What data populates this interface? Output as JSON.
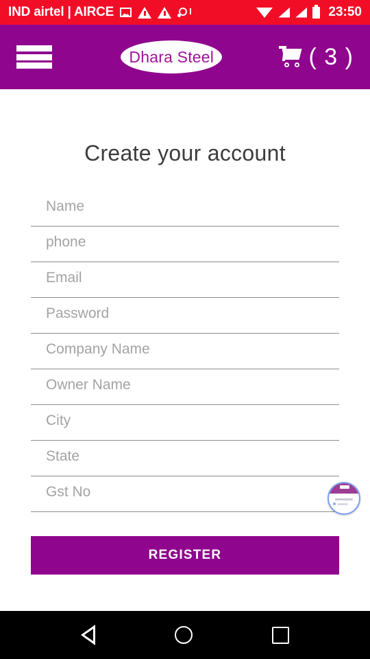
{
  "status_bar": {
    "carrier": "IND airtel | AIRCE",
    "time": "23:50",
    "background_color": "#F20D26",
    "icons": [
      "photo-icon",
      "warning-icon",
      "warning-icon",
      "sim-alert-icon",
      "wifi-icon",
      "signal-icon",
      "signal-icon",
      "battery-icon"
    ]
  },
  "header": {
    "background_color": "#8F058E",
    "menu_label": "menu",
    "logo_text": "Dhara Steel",
    "logo_text_color": "#A0129B",
    "cart_count": "( 3 )"
  },
  "main": {
    "title": "Create your account",
    "fields": [
      {
        "name": "name",
        "placeholder": "Name",
        "value": ""
      },
      {
        "name": "phone",
        "placeholder": "phone",
        "value": ""
      },
      {
        "name": "email",
        "placeholder": "Email",
        "value": ""
      },
      {
        "name": "password",
        "placeholder": "Password",
        "value": ""
      },
      {
        "name": "company-name",
        "placeholder": "Company Name",
        "value": ""
      },
      {
        "name": "owner-name",
        "placeholder": "Owner Name",
        "value": ""
      },
      {
        "name": "city",
        "placeholder": "City",
        "value": ""
      },
      {
        "name": "state",
        "placeholder": "State",
        "value": ""
      },
      {
        "name": "gst-no",
        "placeholder": "Gst No",
        "value": ""
      }
    ],
    "register_label": "REGISTER",
    "register_color": "#8F058E"
  },
  "floating_widget": {
    "name": "chat-bubble-widget",
    "ring_color": "#7D9EF0",
    "band_color": "#9C3C94"
  },
  "nav_bar": {
    "background_color": "#000000",
    "buttons": [
      "back",
      "home",
      "recents"
    ]
  }
}
